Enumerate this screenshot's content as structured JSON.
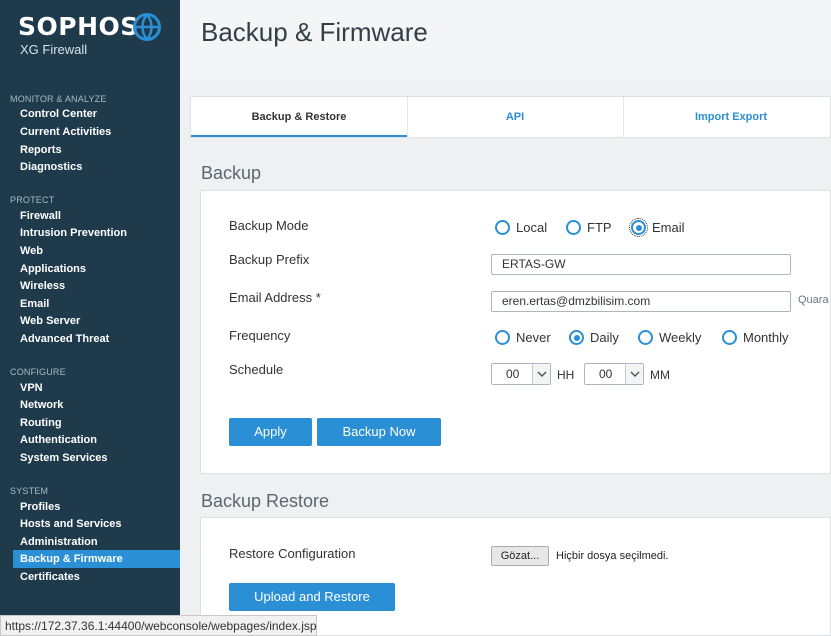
{
  "brand": {
    "name": "SOPHOS",
    "product": "XG Firewall"
  },
  "sidebar": {
    "sections": [
      {
        "title": "MONITOR & ANALYZE",
        "items": [
          "Control Center",
          "Current Activities",
          "Reports",
          "Diagnostics"
        ]
      },
      {
        "title": "PROTECT",
        "items": [
          "Firewall",
          "Intrusion Prevention",
          "Web",
          "Applications",
          "Wireless",
          "Email",
          "Web Server",
          "Advanced Threat"
        ]
      },
      {
        "title": "CONFIGURE",
        "items": [
          "VPN",
          "Network",
          "Routing",
          "Authentication",
          "System Services"
        ]
      },
      {
        "title": "SYSTEM",
        "items": [
          "Profiles",
          "Hosts and Services",
          "Administration",
          "Backup & Firmware",
          "Certificates"
        ]
      }
    ],
    "active_item": "Backup & Firmware"
  },
  "page": {
    "title": "Backup & Firmware"
  },
  "tabs": [
    {
      "label": "Backup & Restore",
      "active": true
    },
    {
      "label": "API",
      "active": false
    },
    {
      "label": "Import Export",
      "active": false
    }
  ],
  "backup": {
    "section_title": "Backup",
    "mode": {
      "label": "Backup Mode",
      "options": [
        "Local",
        "FTP",
        "Email"
      ],
      "selected": "Email"
    },
    "prefix": {
      "label": "Backup Prefix",
      "value": "ERTAS-GW"
    },
    "email": {
      "label": "Email Address *",
      "value": "eren.ertas@dmzbilisim.com",
      "hint": "Quara"
    },
    "frequency": {
      "label": "Frequency",
      "options": [
        "Never",
        "Daily",
        "Weekly",
        "Monthly"
      ],
      "selected": "Daily"
    },
    "schedule": {
      "label": "Schedule",
      "hour": "00",
      "hour_unit": "HH",
      "minute": "00",
      "minute_unit": "MM"
    },
    "apply_label": "Apply",
    "backup_now_label": "Backup Now"
  },
  "restore": {
    "section_title": "Backup Restore",
    "label": "Restore Configuration",
    "file_button": "Gözat...",
    "file_status": "Hiçbir dosya seçilmedi.",
    "upload_label": "Upload and Restore"
  },
  "statusbar": {
    "url": "https://172.37.36.1:44400/webconsole/webpages/index.jsp"
  },
  "colors": {
    "sidebar": "#1e3a4b",
    "accent": "#2a8fd4",
    "background": "#eef0f2"
  },
  "icons": {
    "logo": "sophos-globe-icon",
    "dropdown": "chevron-down-icon"
  }
}
